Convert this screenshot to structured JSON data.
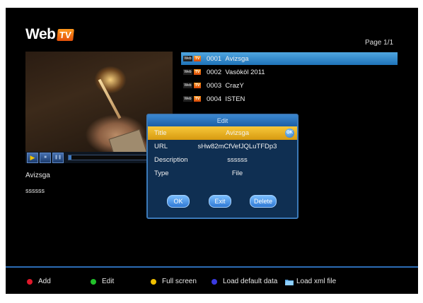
{
  "header": {
    "logo_web": "Web",
    "logo_tv": "TV",
    "page_indicator": "Page 1/1"
  },
  "player": {
    "buttons": [
      {
        "icon": "play-icon",
        "glyph": "▶"
      },
      {
        "icon": "stop-icon",
        "glyph": "■"
      },
      {
        "icon": "pause-icon",
        "glyph": "❚❚"
      }
    ],
    "progress_fraction": 0.03,
    "channel_name": "Avizsga",
    "channel_description": "ssssss"
  },
  "channels": [
    {
      "number": "0001",
      "name": "Avizsga",
      "selected": true
    },
    {
      "number": "0002",
      "name": "Vasököl 2011",
      "selected": false
    },
    {
      "number": "0003",
      "name": "CrazY",
      "selected": false
    },
    {
      "number": "0004",
      "name": "ISTEN",
      "selected": false
    }
  ],
  "channel_icon": {
    "web": "Web",
    "tv": "TV"
  },
  "edit_dialog": {
    "title": "Edit",
    "fields": {
      "title": {
        "label": "Title",
        "value": "Avizsga",
        "badge": "OK"
      },
      "url": {
        "label": "URL",
        "value": "sHw82mCfVefJQLuTFDp3"
      },
      "description": {
        "label": "Description",
        "value": "ssssss"
      },
      "type": {
        "label": "Type",
        "value": "File"
      }
    },
    "buttons": {
      "ok": "OK",
      "exit": "Exit",
      "delete": "Delete"
    }
  },
  "footer": {
    "add": {
      "label": "Add",
      "color": "#e0182a"
    },
    "edit": {
      "label": "Edit",
      "color": "#22c22a"
    },
    "full_screen": {
      "label": "Full screen",
      "color": "#f0c000"
    },
    "load_default": {
      "label": "Load default data",
      "color": "#3a3ae0"
    },
    "load_xml": {
      "label": "Load xml file",
      "icon": "folder-icon"
    }
  }
}
